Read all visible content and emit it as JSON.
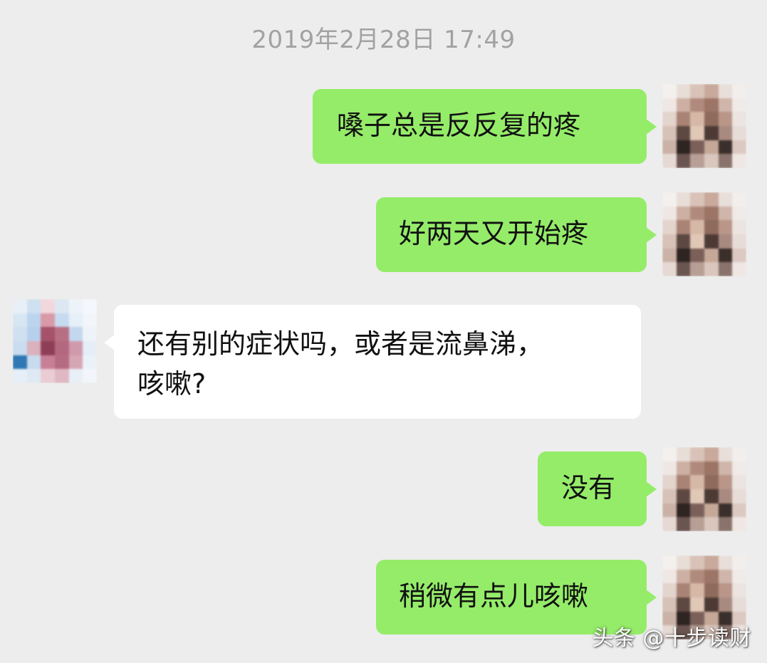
{
  "chat": {
    "timestamp": "2019年2月28日 17:49",
    "messages": [
      {
        "sender": "me",
        "text": "嗓子总是反反复的疼"
      },
      {
        "sender": "me",
        "text": "好两天又开始疼"
      },
      {
        "sender": "other",
        "lines": [
          "还有别的症状吗，或者是流鼻涕，",
          "咳嗽?"
        ]
      },
      {
        "sender": "me",
        "text": "没有"
      },
      {
        "sender": "me",
        "text": "稍微有点儿咳嗽"
      }
    ]
  },
  "watermark": "头条 @十步读财",
  "colors": {
    "background": "#ededed",
    "my_bubble": "#95ec69",
    "other_bubble": "#ffffff",
    "timestamp_text": "#a2a2a2"
  },
  "icons": {
    "my_avatar": "pixelated-avatar-icon",
    "other_avatar": "pixelated-avatar-icon"
  }
}
